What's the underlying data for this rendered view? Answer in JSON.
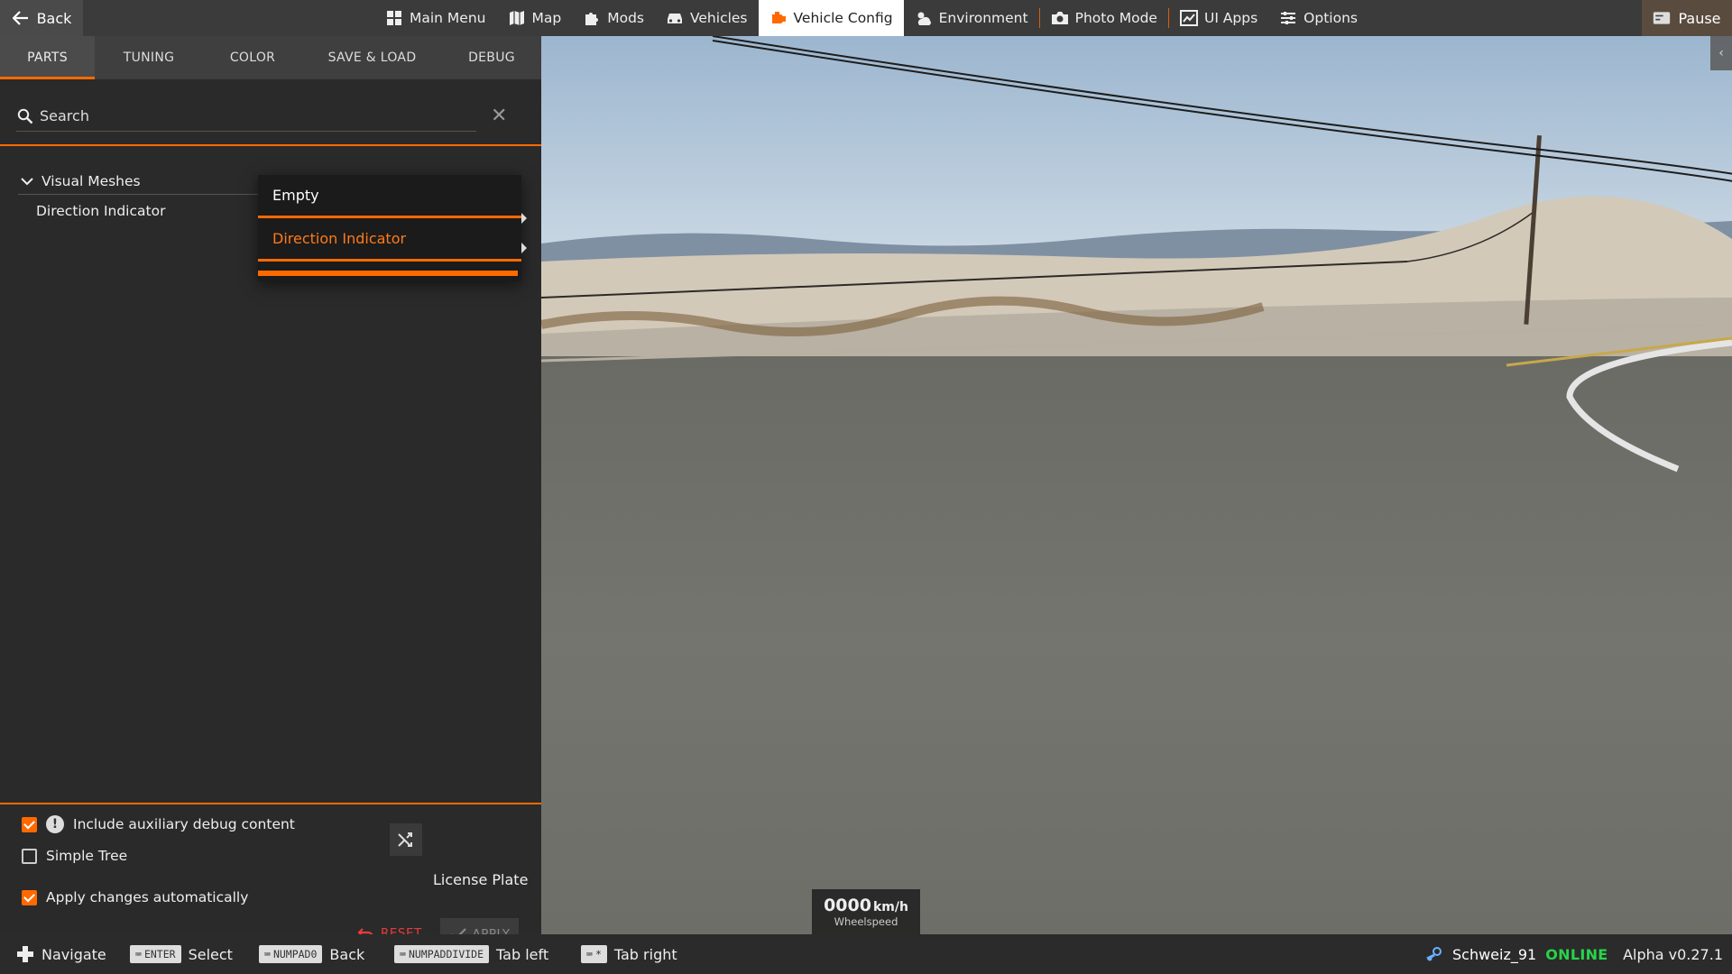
{
  "topbar": {
    "back_label": "Back",
    "pause_label": "Pause",
    "nav": [
      {
        "label": "Main Menu",
        "icon": "grid-icon"
      },
      {
        "label": "Map",
        "icon": "map-icon"
      },
      {
        "label": "Mods",
        "icon": "puzzle-icon"
      },
      {
        "label": "Vehicles",
        "icon": "car-icon"
      },
      {
        "label": "Vehicle Config",
        "icon": "engine-icon",
        "active": true
      },
      {
        "label": "Environment",
        "icon": "weather-icon"
      },
      {
        "label": "Photo Mode",
        "icon": "camera-icon"
      },
      {
        "label": "UI Apps",
        "icon": "ui-apps-icon"
      },
      {
        "label": "Options",
        "icon": "sliders-icon"
      }
    ]
  },
  "panel": {
    "tabs": [
      {
        "label": "PARTS",
        "active": true
      },
      {
        "label": "TUNING"
      },
      {
        "label": "COLOR"
      },
      {
        "label": "SAVE & LOAD"
      },
      {
        "label": "DEBUG"
      }
    ],
    "search": {
      "placeholder": "Search",
      "value": ""
    },
    "tree": {
      "group_label": "Visual Meshes",
      "item_label": "Direction Indicator"
    },
    "dropdown": {
      "options": [
        "Empty",
        "Direction Indicator"
      ],
      "selected": "Direction Indicator"
    },
    "options": {
      "include_debug_label": "Include auxiliary debug content",
      "include_debug_checked": true,
      "simple_tree_label": "Simple Tree",
      "simple_tree_checked": false,
      "apply_auto_label": "Apply changes automatically",
      "apply_auto_checked": true
    },
    "license_plate_label": "License Plate",
    "reset_label": "RESET",
    "apply_label": "APPLY"
  },
  "speedometer": {
    "value": "0000",
    "unit": "km/h",
    "label": "Wheelspeed"
  },
  "statusbar": {
    "hints": [
      {
        "key": "",
        "label": "Navigate"
      },
      {
        "key": "ENTER",
        "label": "Select"
      },
      {
        "key": "NUMPAD0",
        "label": "Back"
      },
      {
        "key": "NUMPADDIVIDE",
        "label": "Tab left"
      },
      {
        "key": "*",
        "label": "Tab right"
      }
    ],
    "username": "Schweiz_91",
    "status": "ONLINE",
    "version": "Alpha v0.27.1"
  },
  "colors": {
    "accent": "#ff6a00",
    "online": "#29d34a",
    "reset": "#e63b3b"
  }
}
